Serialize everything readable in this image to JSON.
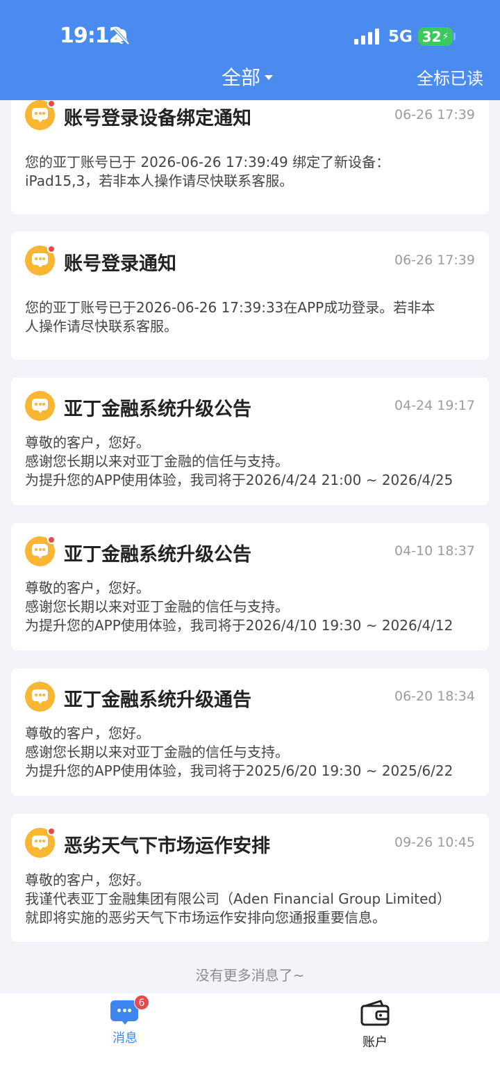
{
  "status_bar": {
    "time": "19:12",
    "network": "5G",
    "battery": "32"
  },
  "header": {
    "filter_label": "全部",
    "mark_all_read": "全标已读"
  },
  "messages": [
    {
      "title": "账号登录设备绑定通知",
      "time": "06-26 17:39",
      "unread": true,
      "lines": [
        "您的亚丁账号已于 2026-06-26 17:39:49 绑定了新设备：",
        "iPad15,3，若非本人操作请尽快联系客服。"
      ]
    },
    {
      "title": "账号登录通知",
      "time": "06-26 17:39",
      "unread": true,
      "lines": [
        "您的亚丁账号已于2026-06-26 17:39:33在APP成功登录。若非本",
        "人操作请尽快联系客服。"
      ]
    },
    {
      "title": "亚丁金融系统升级公告",
      "time": "04-24 19:17",
      "unread": false,
      "lines": [
        "尊敬的客户，您好。",
        "感谢您长期以来对亚丁金融的信任与支持。",
        "为提升您的APP使用体验，我司将于2026/4/24 21:00 ~ 2026/4/25"
      ]
    },
    {
      "title": "亚丁金融系统升级公告",
      "time": "04-10 18:37",
      "unread": true,
      "lines": [
        "尊敬的客户，您好。",
        "感谢您长期以来对亚丁金融的信任与支持。",
        "为提升您的APP使用体验，我司将于2026/4/10 19:30 ~ 2026/4/12"
      ]
    },
    {
      "title": "亚丁金融系统升级通告",
      "time": "06-20 18:34",
      "unread": false,
      "lines": [
        "尊敬的客户，您好。",
        "感谢您长期以来对亚丁金融的信任与支持。",
        "为提升您的APP使用体验，我司将于2025/6/20 19:30 ~ 2025/6/22"
      ]
    },
    {
      "title": "恶劣天气下市场运作安排",
      "time": "09-26 10:45",
      "unread": true,
      "lines": [
        "尊敬的客户，您好。",
        "我谨代表亚丁金融集团有限公司（Aden Financial Group Limited）",
        "就即将实施的恶劣天气下市场运作安排向您通报重要信息。"
      ]
    }
  ],
  "footer_note": "没有更多消息了~",
  "tabbar": {
    "messages_label": "消息",
    "messages_badge": "6",
    "account_label": "账户"
  },
  "colors": {
    "header_bg": "#4b8bf0",
    "icon_orange": "#f8b632",
    "unread_red": "#e9484c",
    "active_tab": "#3d86f0"
  }
}
